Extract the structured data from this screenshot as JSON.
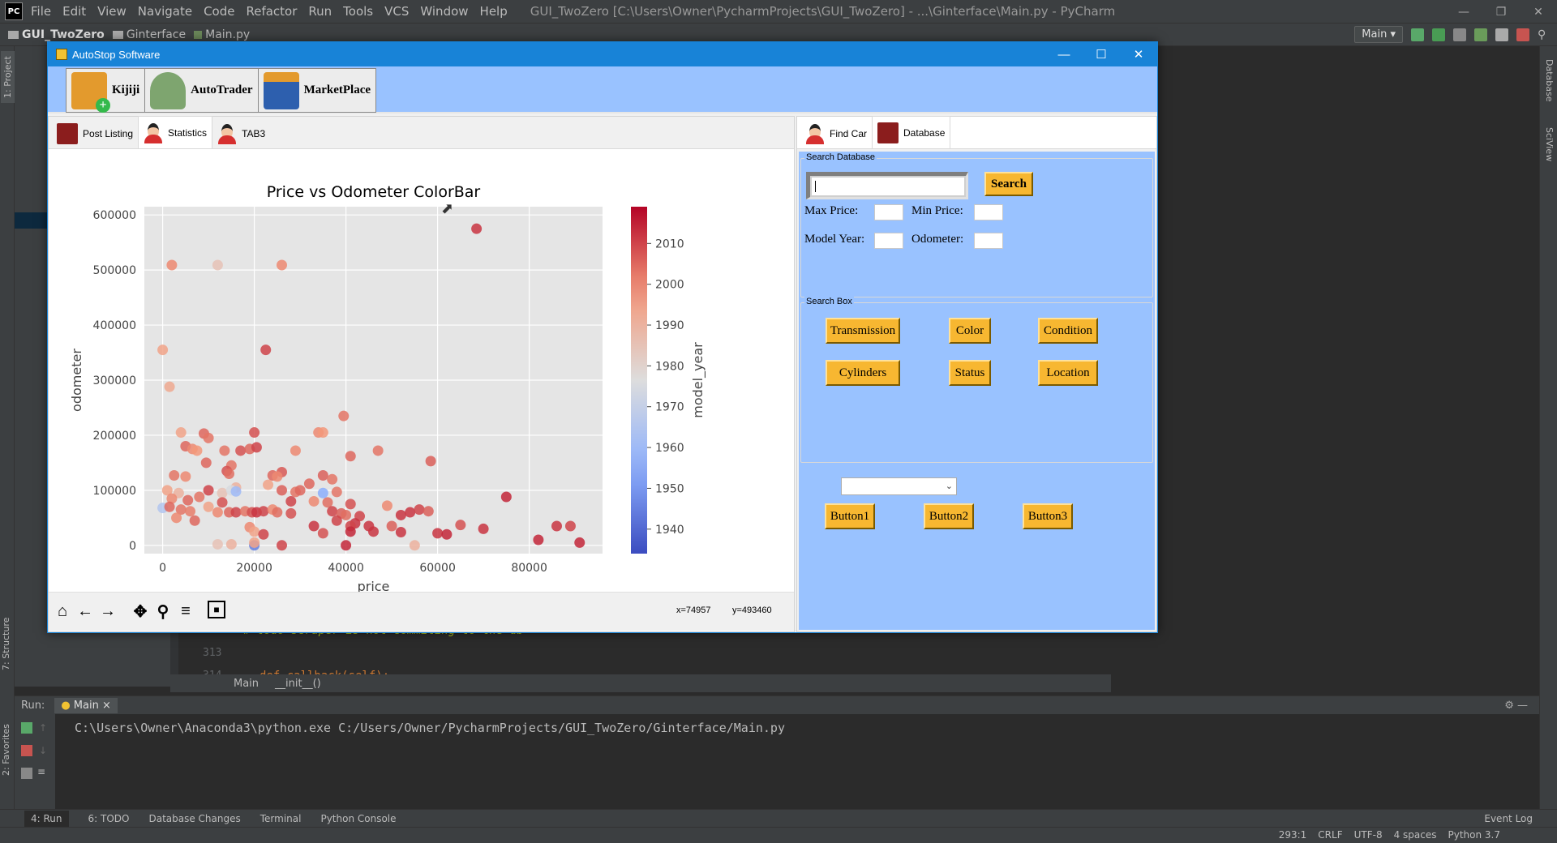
{
  "ide": {
    "logo_text": "PC",
    "menu": [
      "File",
      "Edit",
      "View",
      "Navigate",
      "Code",
      "Refactor",
      "Run",
      "Tools",
      "VCS",
      "Window",
      "Help"
    ],
    "window_title": "GUI_TwoZero [C:\\Users\\Owner\\PycharmProjects\\GUI_TwoZero] - ...\\Ginterface\\Main.py - PyCharm",
    "breadcrumb": [
      "GUI_TwoZero",
      "Ginterface",
      "Main.py"
    ],
    "run_config": "Main",
    "left_vtabs": [
      "1: Project",
      "7: Structure",
      "2: Favorites"
    ],
    "right_vtabs": [
      "Database",
      "SciView"
    ],
    "code_lines": [
      {
        "num": "312",
        "text": "# todo scraper is not commiting to the db"
      },
      {
        "num": "313",
        "text": ""
      },
      {
        "num": "314",
        "text": "def callback(self):"
      }
    ],
    "editor_breadcrumb": [
      "Main",
      "__init__()"
    ],
    "run_label": "Run:",
    "run_tab": "Main",
    "run_output": "C:\\Users\\Owner\\Anaconda3\\python.exe C:/Users/Owner/PycharmProjects/GUI_TwoZero/Ginterface/Main.py",
    "bottom_tools": [
      "4: Run",
      "6: TODO",
      "Database Changes",
      "Terminal",
      "Python Console"
    ],
    "event_log": "Event Log",
    "status": {
      "position": "293:1",
      "line_sep": "CRLF",
      "encoding": "UTF-8",
      "indent": "4 spaces",
      "interpreter": "Python 3.7"
    }
  },
  "app": {
    "title": "AutoStop Software",
    "toolbar": [
      {
        "label": "Kijiji",
        "icon": "kijiji-icon"
      },
      {
        "label": "AutoTrader",
        "icon": "autotrader-icon"
      },
      {
        "label": "MarketPlace",
        "icon": "marketplace-icon"
      }
    ],
    "left_tabs": [
      {
        "label": "Post Listing",
        "icon": "book-icon"
      },
      {
        "label": "Statistics",
        "icon": "person-icon",
        "selected": true
      },
      {
        "label": "TAB3",
        "icon": "person-icon"
      }
    ],
    "right_tabs": [
      {
        "label": "Find Car",
        "icon": "person-icon"
      },
      {
        "label": "Database",
        "icon": "book-icon",
        "selected": true
      }
    ],
    "search_database": {
      "title": "Search Database",
      "search_button": "Search",
      "max_price_label": "Max Price:",
      "min_price_label": "Min Price:",
      "model_year_label": "Model Year:",
      "odometer_label": "Odometer:"
    },
    "search_box": {
      "title": "Search Box",
      "buttons": [
        "Transmission",
        "Color",
        "Condition",
        "Cylinders",
        "Status",
        "Location"
      ]
    },
    "bottom_buttons": [
      "Button1",
      "Button2",
      "Button3"
    ],
    "combo_value": "",
    "mpl": {
      "x_readout": "x=74957",
      "y_readout": "y=493460"
    }
  },
  "chart_data": {
    "type": "scatter",
    "title": "Price vs Odometer ColorBar",
    "xlabel": "price",
    "ylabel": "odometer",
    "xlim": [
      -4000,
      96000
    ],
    "ylim": [
      -15000,
      615000
    ],
    "xticks": [
      0,
      20000,
      40000,
      60000,
      80000
    ],
    "yticks": [
      0,
      100000,
      200000,
      300000,
      400000,
      500000,
      600000
    ],
    "colorbar": {
      "label": "model_year",
      "range": [
        1934,
        2019
      ],
      "ticks": [
        1940,
        1950,
        1960,
        1970,
        1980,
        1990,
        2000,
        2010
      ],
      "colormap": "coolwarm"
    },
    "grid": true,
    "background": "#e5e5e5",
    "points": [
      {
        "x": 68500,
        "y": 575000,
        "c": 2012
      },
      {
        "x": 2000,
        "y": 509000,
        "c": 2000
      },
      {
        "x": 12000,
        "y": 509000,
        "c": 1985
      },
      {
        "x": 26000,
        "y": 509000,
        "c": 2000
      },
      {
        "x": 0,
        "y": 355000,
        "c": 1995
      },
      {
        "x": 22500,
        "y": 355000,
        "c": 2010
      },
      {
        "x": 1500,
        "y": 288000,
        "c": 1993
      },
      {
        "x": 39500,
        "y": 235000,
        "c": 2003
      },
      {
        "x": 4000,
        "y": 205000,
        "c": 1995
      },
      {
        "x": 9000,
        "y": 203000,
        "c": 2005
      },
      {
        "x": 20000,
        "y": 205000,
        "c": 2008
      },
      {
        "x": 34000,
        "y": 205000,
        "c": 2000
      },
      {
        "x": 35000,
        "y": 205000,
        "c": 1998
      },
      {
        "x": 10000,
        "y": 195000,
        "c": 2003
      },
      {
        "x": 5000,
        "y": 180000,
        "c": 2005
      },
      {
        "x": 6500,
        "y": 175000,
        "c": 2000
      },
      {
        "x": 7500,
        "y": 172000,
        "c": 1998
      },
      {
        "x": 13500,
        "y": 172000,
        "c": 2003
      },
      {
        "x": 17000,
        "y": 172000,
        "c": 2008
      },
      {
        "x": 19000,
        "y": 175000,
        "c": 2005
      },
      {
        "x": 20500,
        "y": 178000,
        "c": 2010
      },
      {
        "x": 29000,
        "y": 172000,
        "c": 2000
      },
      {
        "x": 41000,
        "y": 162000,
        "c": 2005
      },
      {
        "x": 47000,
        "y": 172000,
        "c": 2003
      },
      {
        "x": 58500,
        "y": 153000,
        "c": 2006
      },
      {
        "x": 9500,
        "y": 150000,
        "c": 2005
      },
      {
        "x": 15000,
        "y": 145000,
        "c": 2003
      },
      {
        "x": 14000,
        "y": 135000,
        "c": 2008
      },
      {
        "x": 26000,
        "y": 133000,
        "c": 2007
      },
      {
        "x": 2500,
        "y": 127000,
        "c": 2003
      },
      {
        "x": 5000,
        "y": 125000,
        "c": 2000
      },
      {
        "x": 24000,
        "y": 127000,
        "c": 2005
      },
      {
        "x": 25000,
        "y": 125000,
        "c": 2000
      },
      {
        "x": 35000,
        "y": 127000,
        "c": 2006
      },
      {
        "x": 37000,
        "y": 120000,
        "c": 2003
      },
      {
        "x": 14500,
        "y": 130000,
        "c": 2004
      },
      {
        "x": 16000,
        "y": 105000,
        "c": 1990
      },
      {
        "x": 23000,
        "y": 110000,
        "c": 1995
      },
      {
        "x": 32000,
        "y": 112000,
        "c": 2005
      },
      {
        "x": 1000,
        "y": 100000,
        "c": 1995
      },
      {
        "x": 3500,
        "y": 95000,
        "c": 1990
      },
      {
        "x": 10000,
        "y": 100000,
        "c": 2010
      },
      {
        "x": 13000,
        "y": 95000,
        "c": 1985
      },
      {
        "x": 15000,
        "y": 100000,
        "c": 1975
      },
      {
        "x": 16000,
        "y": 98000,
        "c": 1960
      },
      {
        "x": 26000,
        "y": 100000,
        "c": 2006
      },
      {
        "x": 29000,
        "y": 97000,
        "c": 2003
      },
      {
        "x": 30000,
        "y": 100000,
        "c": 2005
      },
      {
        "x": 35000,
        "y": 95000,
        "c": 1955
      },
      {
        "x": 38000,
        "y": 97000,
        "c": 2003
      },
      {
        "x": 2000,
        "y": 85000,
        "c": 2000
      },
      {
        "x": 8000,
        "y": 88000,
        "c": 2003
      },
      {
        "x": 5500,
        "y": 82000,
        "c": 2005
      },
      {
        "x": 13000,
        "y": 78000,
        "c": 2008
      },
      {
        "x": 28000,
        "y": 80000,
        "c": 2010
      },
      {
        "x": 33000,
        "y": 80000,
        "c": 2000
      },
      {
        "x": 36000,
        "y": 78000,
        "c": 2004
      },
      {
        "x": 41000,
        "y": 75000,
        "c": 2008
      },
      {
        "x": 49000,
        "y": 72000,
        "c": 2000
      },
      {
        "x": 75000,
        "y": 88000,
        "c": 2014
      },
      {
        "x": 0,
        "y": 68000,
        "c": 1965
      },
      {
        "x": 1500,
        "y": 70000,
        "c": 2005
      },
      {
        "x": 4000,
        "y": 65000,
        "c": 2003
      },
      {
        "x": 6000,
        "y": 62000,
        "c": 2002
      },
      {
        "x": 10000,
        "y": 70000,
        "c": 1995
      },
      {
        "x": 12000,
        "y": 60000,
        "c": 2000
      },
      {
        "x": 14500,
        "y": 60000,
        "c": 2005
      },
      {
        "x": 16000,
        "y": 60000,
        "c": 2010
      },
      {
        "x": 18000,
        "y": 62000,
        "c": 2003
      },
      {
        "x": 19500,
        "y": 60000,
        "c": 2008
      },
      {
        "x": 20500,
        "y": 60000,
        "c": 2012
      },
      {
        "x": 22000,
        "y": 62000,
        "c": 2010
      },
      {
        "x": 24000,
        "y": 65000,
        "c": 2000
      },
      {
        "x": 25000,
        "y": 60000,
        "c": 2004
      },
      {
        "x": 28000,
        "y": 58000,
        "c": 2008
      },
      {
        "x": 37000,
        "y": 62000,
        "c": 2010
      },
      {
        "x": 39000,
        "y": 58000,
        "c": 2006
      },
      {
        "x": 40000,
        "y": 55000,
        "c": 2004
      },
      {
        "x": 43000,
        "y": 53000,
        "c": 2010
      },
      {
        "x": 52000,
        "y": 55000,
        "c": 2012
      },
      {
        "x": 54000,
        "y": 60000,
        "c": 2012
      },
      {
        "x": 56000,
        "y": 65000,
        "c": 2010
      },
      {
        "x": 58000,
        "y": 62000,
        "c": 2006
      },
      {
        "x": 3000,
        "y": 50000,
        "c": 2000
      },
      {
        "x": 7000,
        "y": 45000,
        "c": 2005
      },
      {
        "x": 38000,
        "y": 45000,
        "c": 2010
      },
      {
        "x": 42000,
        "y": 40000,
        "c": 2012
      },
      {
        "x": 19000,
        "y": 33000,
        "c": 2000
      },
      {
        "x": 33000,
        "y": 35000,
        "c": 2012
      },
      {
        "x": 41000,
        "y": 35000,
        "c": 2010
      },
      {
        "x": 45000,
        "y": 35000,
        "c": 2012
      },
      {
        "x": 50000,
        "y": 35000,
        "c": 2006
      },
      {
        "x": 65000,
        "y": 37000,
        "c": 2008
      },
      {
        "x": 20000,
        "y": 25000,
        "c": 1995
      },
      {
        "x": 22000,
        "y": 20000,
        "c": 2010
      },
      {
        "x": 35000,
        "y": 22000,
        "c": 2008
      },
      {
        "x": 41000,
        "y": 25000,
        "c": 2014
      },
      {
        "x": 46000,
        "y": 25000,
        "c": 2012
      },
      {
        "x": 52000,
        "y": 24000,
        "c": 2012
      },
      {
        "x": 60000,
        "y": 22000,
        "c": 2012
      },
      {
        "x": 62000,
        "y": 20000,
        "c": 2014
      },
      {
        "x": 70000,
        "y": 30000,
        "c": 2012
      },
      {
        "x": 82000,
        "y": 10000,
        "c": 2014
      },
      {
        "x": 86000,
        "y": 35000,
        "c": 2012
      },
      {
        "x": 89000,
        "y": 35000,
        "c": 2010
      },
      {
        "x": 91000,
        "y": 5000,
        "c": 2014
      },
      {
        "x": 12000,
        "y": 2000,
        "c": 1985
      },
      {
        "x": 15000,
        "y": 2000,
        "c": 1990
      },
      {
        "x": 20000,
        "y": 0,
        "c": 1945
      },
      {
        "x": 20000,
        "y": 5000,
        "c": 1995
      },
      {
        "x": 26000,
        "y": 0,
        "c": 2010
      },
      {
        "x": 40000,
        "y": 0,
        "c": 2014
      },
      {
        "x": 55000,
        "y": 0,
        "c": 1990
      }
    ]
  }
}
